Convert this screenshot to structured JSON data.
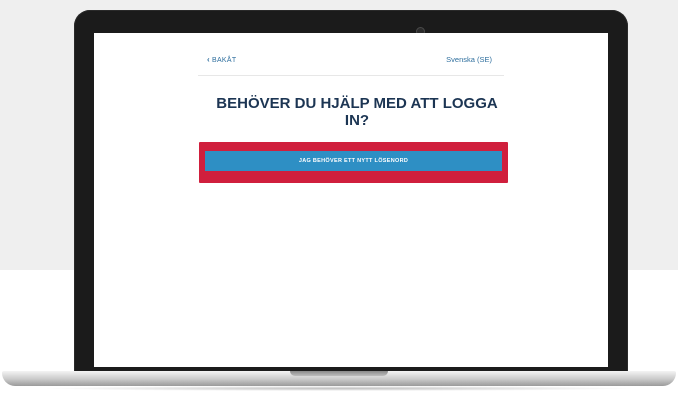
{
  "header": {
    "back_label": "BAKÅT",
    "language": "Svenska (SE)"
  },
  "main": {
    "title": "BEHÖVER DU HJÄLP MED ATT LOGGA IN?",
    "new_password_button": "JAG BEHÖVER ETT NYTT LÖSENORD"
  },
  "colors": {
    "title": "#1c3553",
    "button": "#2e8fc4",
    "highlight": "#d01f3d",
    "link": "#2f6f9e"
  },
  "icons": {
    "back": "chevron-left-icon",
    "camera": "camera-icon"
  }
}
